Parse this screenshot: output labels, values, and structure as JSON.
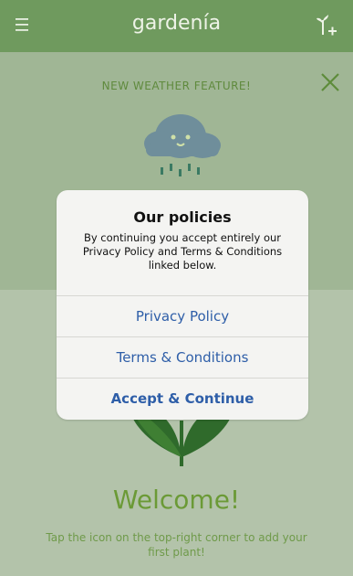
{
  "app": {
    "title": "gardenía"
  },
  "banner": {
    "feature_text": "NEW WEATHER FEATURE!"
  },
  "dialog": {
    "title": "Our policies",
    "message": "By continuing you accept entirely our Privacy Policy and Terms & Conditions linked below.",
    "buttons": [
      "Privacy Policy",
      "Terms & Conditions",
      "Accept & Continue"
    ]
  },
  "welcome": {
    "heading": "Welcome!",
    "tagline": "Tap the icon on the top-right corner to add your first plant!"
  },
  "icons": {
    "menu": "menu-icon",
    "add_plant": "add-plant-icon",
    "close": "close-icon",
    "cloud": "rain-cloud-icon",
    "plant": "plant-icon"
  },
  "colors": {
    "header": "#6f9a5e",
    "accent_green": "#6b9a36",
    "link_blue": "#2e5ea8"
  }
}
